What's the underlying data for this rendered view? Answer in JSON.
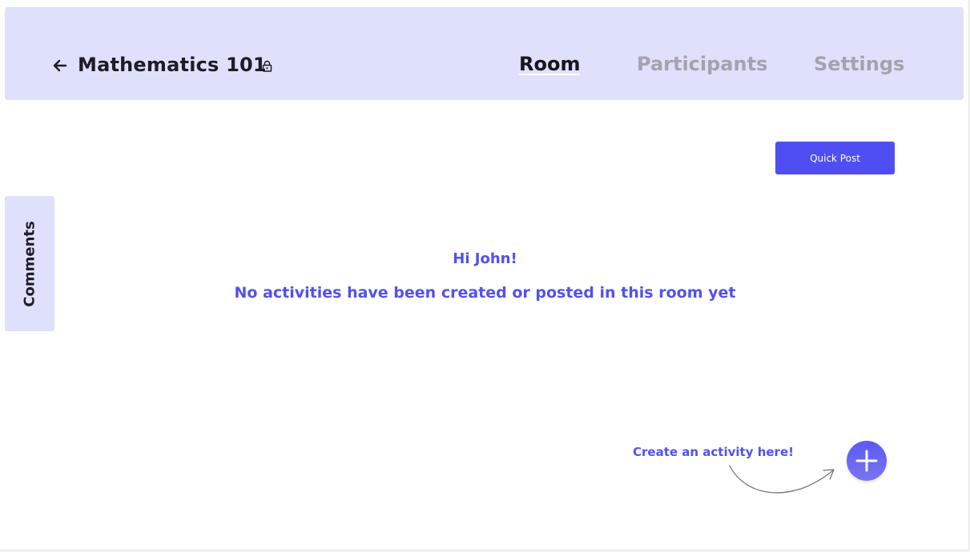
{
  "header": {
    "title": "Mathematics  101",
    "back_icon": "arrow-left-icon",
    "lock_icon": "lock-icon",
    "tabs": [
      {
        "label": "Room",
        "active": true
      },
      {
        "label": "Participants",
        "active": false
      },
      {
        "label": "Settings",
        "active": false
      }
    ]
  },
  "toolbar": {
    "quick_post_label": "Quick Post"
  },
  "sidebar": {
    "comments_label": "Comments"
  },
  "main": {
    "greeting": "Hi John!",
    "empty_message": "No activities have been created or posted in this room yet"
  },
  "create": {
    "hint": "Create an activity here!",
    "add_icon": "plus-icon"
  },
  "colors": {
    "header_bg": "#dfe0fc",
    "accent": "#4f4ef3",
    "text_accent": "#5151f0",
    "tab_inactive": "#a3a3ad",
    "text_dark": "#1d1d26"
  }
}
